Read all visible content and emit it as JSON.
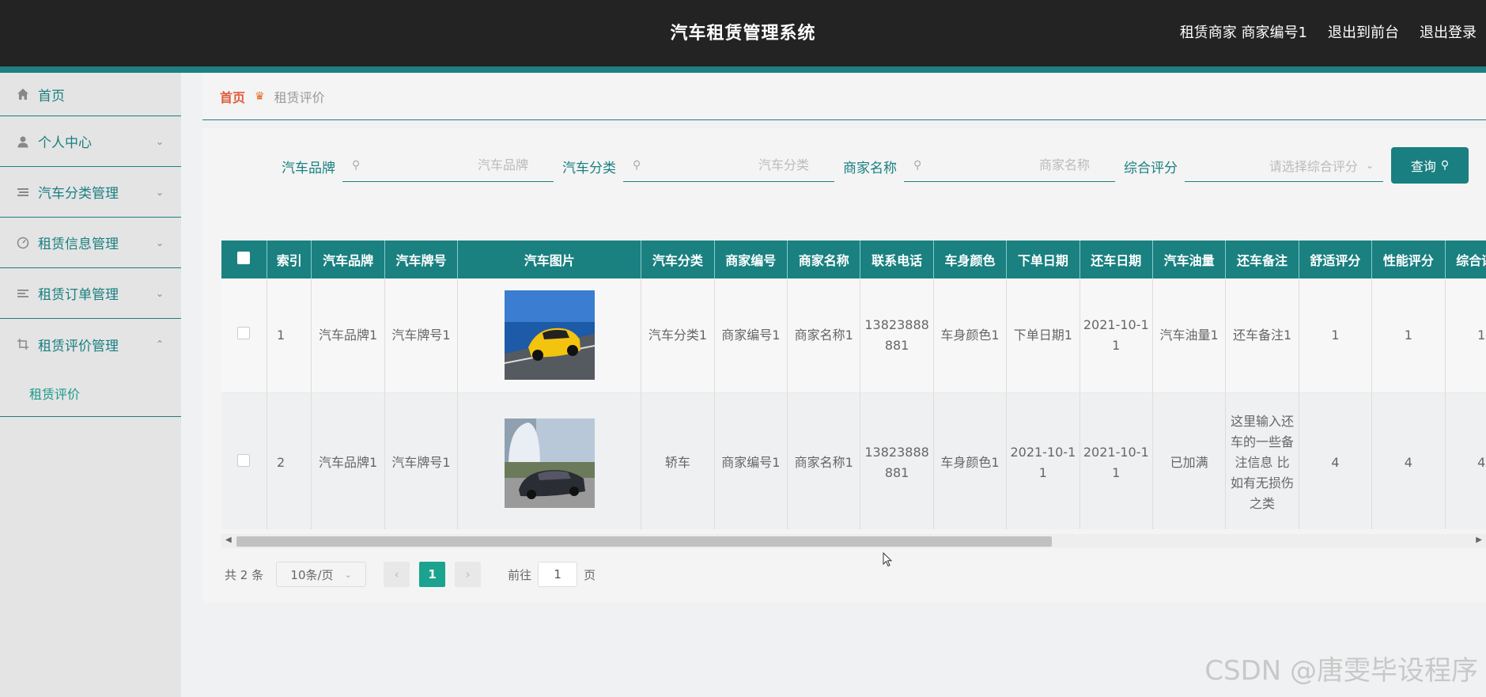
{
  "header": {
    "title": "汽车租赁管理系统",
    "user_info": "租赁商家 商家编号1",
    "goto_front": "退出到前台",
    "logout": "退出登录"
  },
  "sidebar": {
    "items": [
      {
        "label": "首页",
        "icon": "home-icon"
      },
      {
        "label": "个人中心",
        "icon": "user-icon"
      },
      {
        "label": "汽车分类管理",
        "icon": "list-icon"
      },
      {
        "label": "租赁信息管理",
        "icon": "gauge-icon"
      },
      {
        "label": "租赁订单管理",
        "icon": "menu-icon"
      },
      {
        "label": "租赁评价管理",
        "icon": "crop-icon"
      }
    ],
    "submenu": {
      "label": "租赁评价"
    }
  },
  "breadcrumb": {
    "home": "首页",
    "current": "租赁评价"
  },
  "search": {
    "brand_label": "汽车品牌",
    "brand_placeholder": "汽车品牌",
    "category_label": "汽车分类",
    "category_placeholder": "汽车分类",
    "merchant_label": "商家名称",
    "merchant_placeholder": "商家名称",
    "rating_label": "综合评分",
    "rating_placeholder": "请选择综合评分",
    "query_button": "查询"
  },
  "table": {
    "headers": [
      "索引",
      "汽车品牌",
      "汽车牌号",
      "汽车图片",
      "汽车分类",
      "商家编号",
      "商家名称",
      "联系电话",
      "车身颜色",
      "下单日期",
      "还车日期",
      "汽车油量",
      "还车备注",
      "舒适评分",
      "性能评分",
      "综合评分"
    ],
    "rows": [
      {
        "index": "1",
        "brand": "汽车品牌1",
        "plate": "汽车牌号1",
        "category": "汽车分类1",
        "merchant_no": "商家编号1",
        "merchant_name": "商家名称1",
        "phone": "13823888881",
        "color": "车身颜色1",
        "order_date": "下单日期1",
        "return_date": "2021-10-11",
        "fuel": "汽车油量1",
        "remark": "还车备注1",
        "comfort": "1",
        "performance": "1",
        "overall": "1"
      },
      {
        "index": "2",
        "brand": "汽车品牌1",
        "plate": "汽车牌号1",
        "category": "轿车",
        "merchant_no": "商家编号1",
        "merchant_name": "商家名称1",
        "phone": "13823888881",
        "color": "车身颜色1",
        "order_date": "2021-10-11",
        "return_date": "2021-10-11",
        "fuel": "已加满",
        "remark": "这里输入还车的一些备注信息 比如有无损伤之类",
        "comfort": "4",
        "performance": "4",
        "overall": "4"
      }
    ]
  },
  "pagination": {
    "total": "共 2 条",
    "page_size": "10条/页",
    "current_page": "1",
    "goto_label": "前往",
    "goto_value": "1",
    "page_unit": "页"
  },
  "watermark": "CSDN @唐雯毕设程序",
  "colors": {
    "header_bg": "#232323",
    "accent": "#1a7f80",
    "page_active": "#1ba38f"
  }
}
